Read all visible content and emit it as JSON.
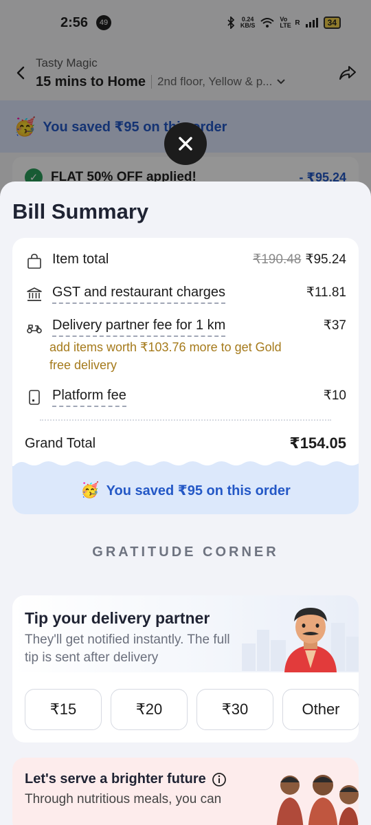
{
  "status_bar": {
    "time": "2:56",
    "notification_count": "49",
    "net_speed_value": "0.24",
    "net_speed_unit": "KB/S",
    "volte": "Vo LTE",
    "roaming": "R",
    "battery": "34"
  },
  "header": {
    "restaurant": "Tasty Magic",
    "eta": "15 mins to Home",
    "address": "2nd floor, Yellow & p..."
  },
  "background": {
    "saved_banner": "You saved ₹95 on this order",
    "offer_text": "FLAT 50% OFF applied!",
    "offer_amount": "- ₹95.24"
  },
  "bill_summary": {
    "title": "Bill Summary",
    "item_total_label": "Item total",
    "item_total_original": "₹190.48",
    "item_total_value": "₹95.24",
    "gst_label": "GST and restaurant charges",
    "gst_value": "₹11.81",
    "delivery_label": "Delivery partner fee for 1 km",
    "delivery_value": "₹37",
    "delivery_note": "add items worth ₹103.76 more to get Gold free delivery",
    "platform_label": "Platform fee",
    "platform_value": "₹10",
    "grand_total_label": "Grand Total",
    "grand_total_value": "₹154.05",
    "savings_text": "You saved ₹95 on this order"
  },
  "gratitude_heading": "GRATITUDE CORNER",
  "tip": {
    "title": "Tip your delivery partner",
    "subtitle": "They'll get notified instantly. The full tip is sent after delivery",
    "options": [
      "₹15",
      "₹20",
      "₹30",
      "Other"
    ]
  },
  "future": {
    "title": "Let's serve a brighter future",
    "subtitle": "Through nutritious meals, you can"
  },
  "colors": {
    "accent_blue": "#2458c6",
    "note_gold": "#a57a1b",
    "success_green": "#2a9d5a"
  }
}
